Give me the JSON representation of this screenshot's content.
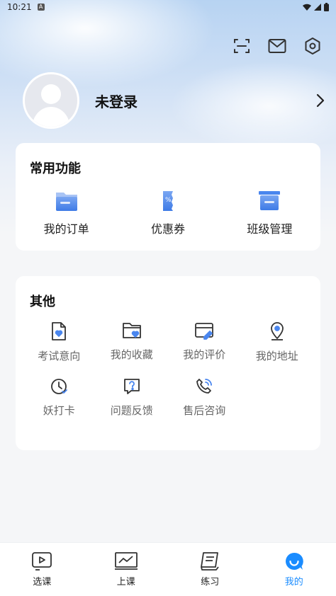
{
  "status": {
    "time": "10:21",
    "notification_badge": "A"
  },
  "header": {
    "icons": [
      "scan-icon",
      "mail-icon",
      "settings-icon"
    ]
  },
  "profile": {
    "name": "未登录"
  },
  "common": {
    "title": "常用功能",
    "items": [
      {
        "label": "我的订单",
        "icon": "folder-icon"
      },
      {
        "label": "优惠券",
        "icon": "coupon-icon"
      },
      {
        "label": "班级管理",
        "icon": "class-board-icon"
      }
    ]
  },
  "other": {
    "title": "其他",
    "items": [
      {
        "label": "考试意向",
        "icon": "exam-heart-icon"
      },
      {
        "label": "我的收藏",
        "icon": "folder-heart-icon"
      },
      {
        "label": "我的评价",
        "icon": "card-pen-icon"
      },
      {
        "label": "我的地址",
        "icon": "location-pin-icon"
      },
      {
        "label": "妖打卡",
        "icon": "clock-check-icon"
      },
      {
        "label": "问题反馈",
        "icon": "feedback-question-icon"
      },
      {
        "label": "售后咨询",
        "icon": "phone-call-icon"
      }
    ]
  },
  "tabs": [
    {
      "label": "选课",
      "icon": "play-board-icon",
      "active": false
    },
    {
      "label": "上课",
      "icon": "monitor-chart-icon",
      "active": false
    },
    {
      "label": "练习",
      "icon": "notebook-icon",
      "active": false
    },
    {
      "label": "我的",
      "icon": "smile-bubble-icon",
      "active": true
    }
  ],
  "colors": {
    "accent": "#1a8cff",
    "card_icon_blue": "#4a86ee"
  }
}
